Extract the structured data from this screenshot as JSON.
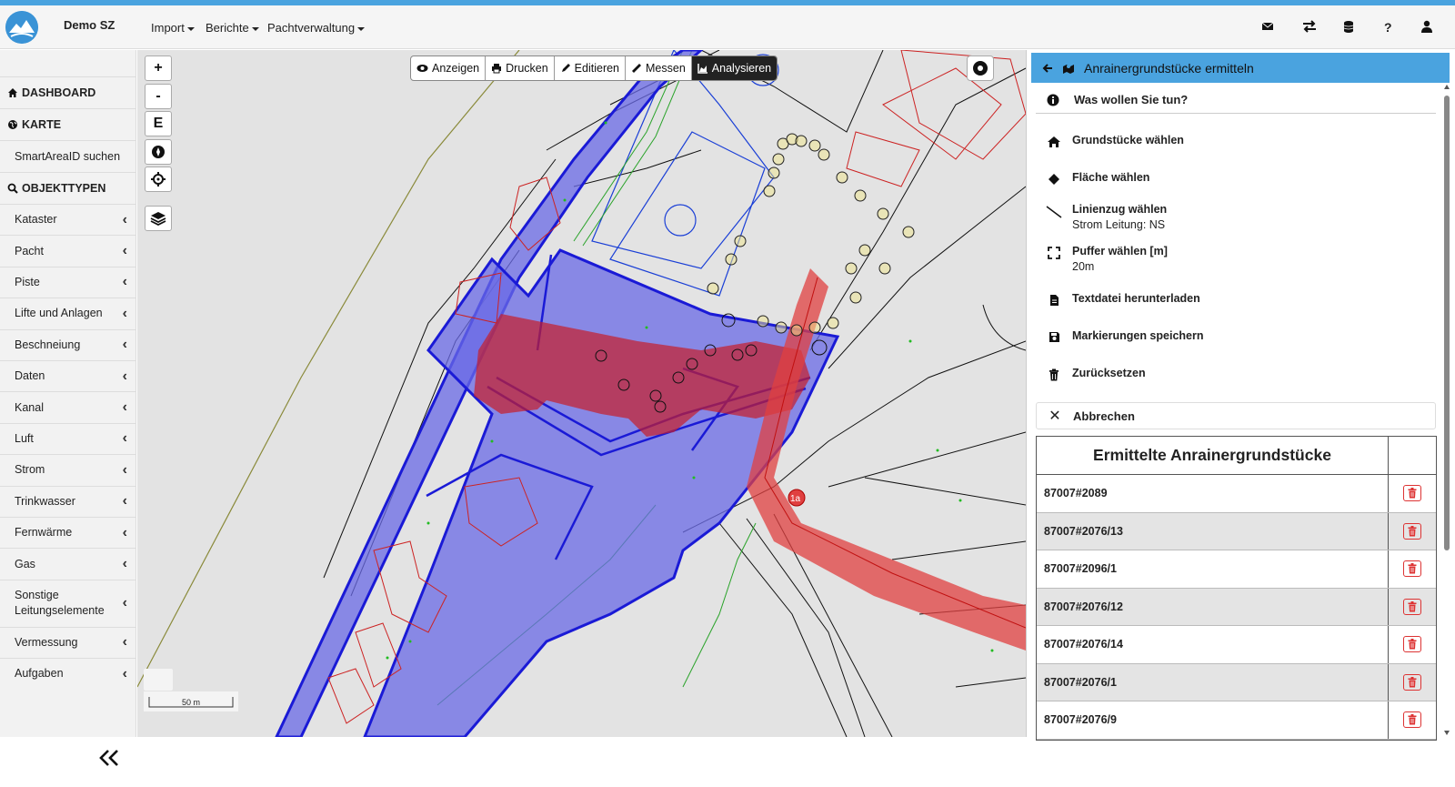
{
  "app": {
    "brand": "Demo SZ"
  },
  "topnav": {
    "menus": [
      "Import",
      "Berichte",
      "Pachtverwaltung"
    ],
    "icons": [
      "envelope-icon",
      "exchange-icon",
      "database-icon",
      "help-icon",
      "user-icon"
    ]
  },
  "sidebar": {
    "dashboard": "DASHBOARD",
    "karte": "KARTE",
    "smartarea": "SmartAreaID suchen",
    "objekttypen": "OBJEKTTYPEN",
    "items": [
      "Kataster",
      "Pacht",
      "Piste",
      "Lifte und Anlagen",
      "Beschneiung",
      "Daten",
      "Kanal",
      "Luft",
      "Strom",
      "Trinkwasser",
      "Fernwärme",
      "Gas",
      "Sonstige Leitungselemente",
      "Vermessung",
      "Aufgaben"
    ],
    "collapse_icon": "double-chevron-left-icon"
  },
  "map": {
    "zoom_in": "+",
    "zoom_out": "-",
    "e_button": "E",
    "toolbar": [
      "Anzeigen",
      "Drucken",
      "Editieren",
      "Messen",
      "Analysieren"
    ],
    "active_tool": "Analysieren",
    "scale_label": "50 m",
    "label_1a": "1a"
  },
  "panel": {
    "title": "Anrainergrundstücke ermitteln",
    "question": "Was wollen Sie tun?",
    "options": [
      {
        "label": "Grundstücke wählen",
        "sub": "",
        "icon": "home-icon"
      },
      {
        "label": "Fläche wählen",
        "sub": "",
        "icon": "diamond-icon"
      },
      {
        "label": "Linienzug wählen",
        "sub": "Strom Leitung: NS",
        "icon": "line-icon"
      },
      {
        "label": "Puffer wählen [m]",
        "sub": "20m",
        "icon": "expand-icon"
      },
      {
        "label": "Textdatei herunterladen",
        "sub": "",
        "icon": "file-icon"
      },
      {
        "label": "Markierungen speichern",
        "sub": "",
        "icon": "save-icon"
      },
      {
        "label": "Zurücksetzen",
        "sub": "",
        "icon": "trash-icon"
      }
    ],
    "cancel": "Abbrechen",
    "table_title": "Ermittelte Anrainergrundstücke",
    "rows": [
      "87007#2089",
      "87007#2076/13",
      "87007#2096/1",
      "87007#2076/12",
      "87007#2076/14",
      "87007#2076/1",
      "87007#2076/9"
    ]
  },
  "colors": {
    "accent": "#4aa3df",
    "buffer": "#d7262b",
    "parcels": "#3333dd"
  }
}
